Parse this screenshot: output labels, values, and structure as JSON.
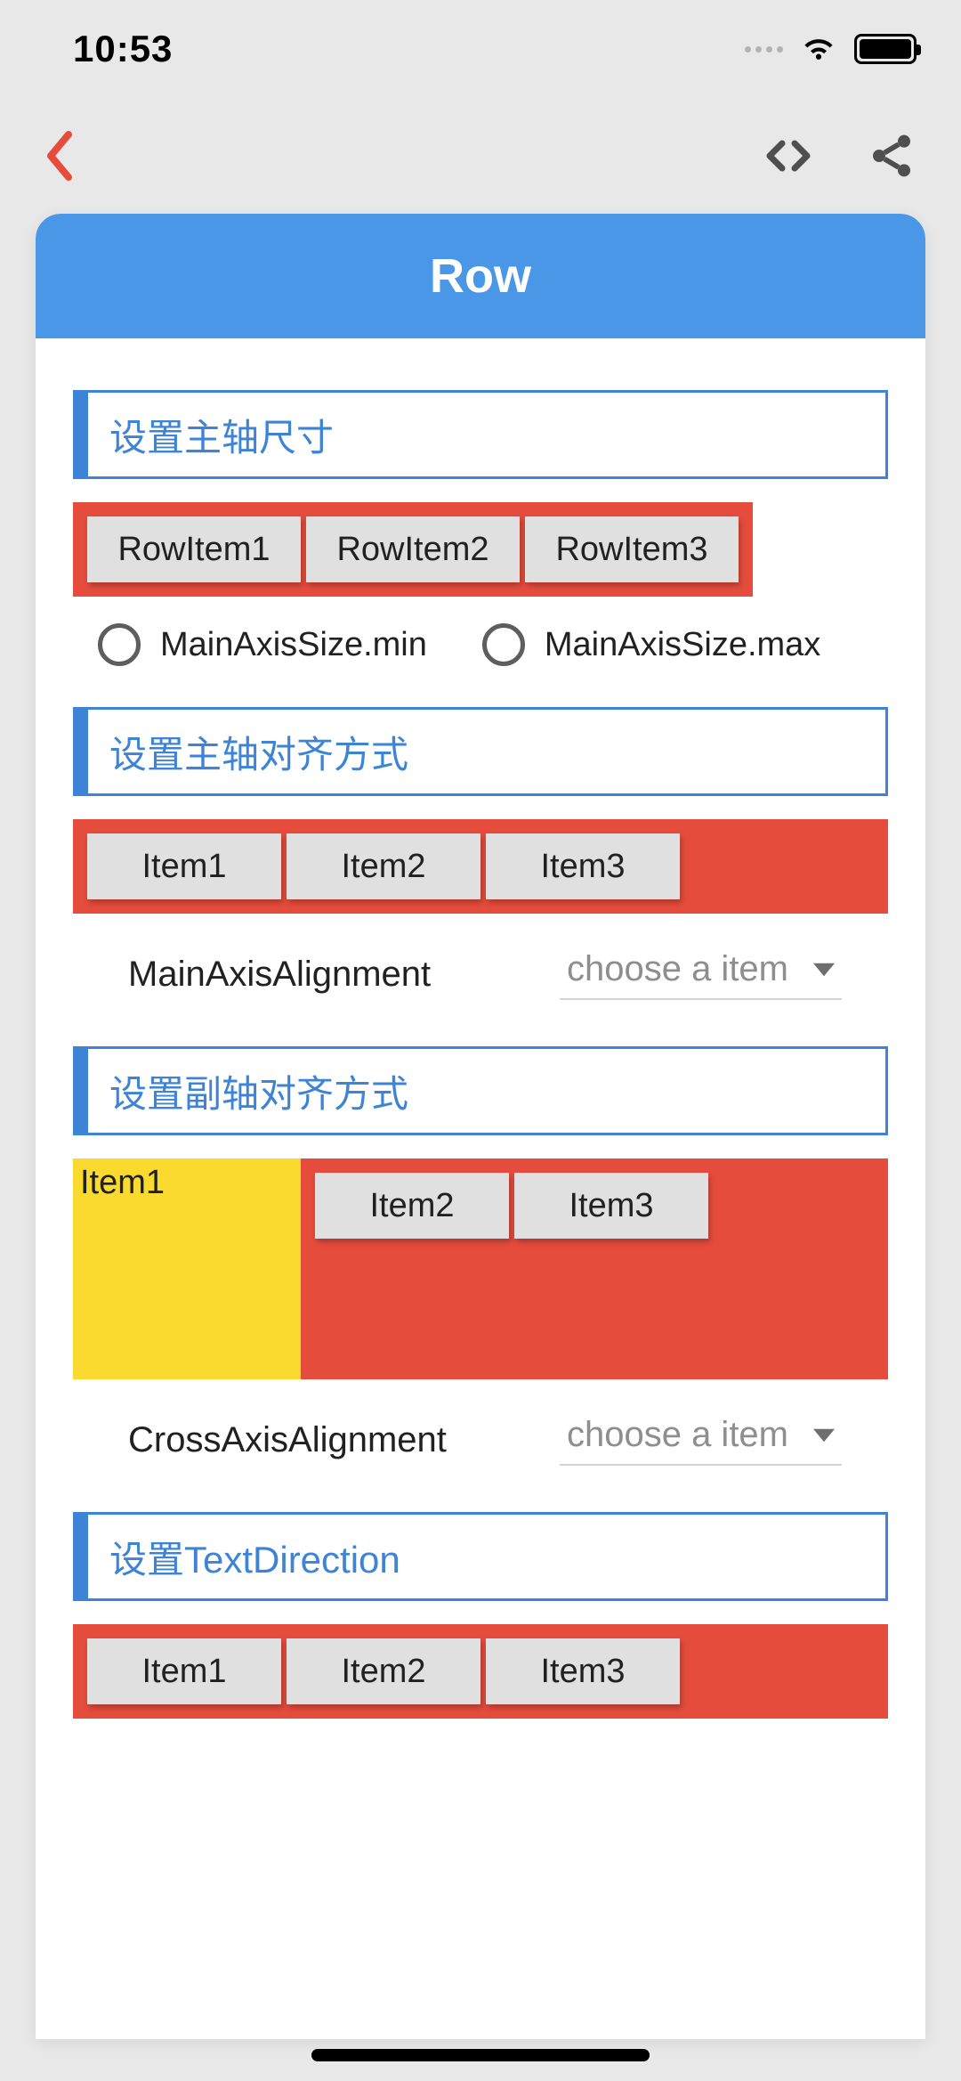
{
  "status": {
    "time": "10:53"
  },
  "header": {
    "title": "Row"
  },
  "sections": {
    "mainAxisSize": {
      "title": "设置主轴尺寸",
      "items": [
        "RowItem1",
        "RowItem2",
        "RowItem3"
      ],
      "options": [
        "MainAxisSize.min",
        "MainAxisSize.max"
      ]
    },
    "mainAxisAlignment": {
      "title": "设置主轴对齐方式",
      "items": [
        "Item1",
        "Item2",
        "Item3"
      ],
      "label": "MainAxisAlignment",
      "placeholder": "choose a item"
    },
    "crossAxisAlignment": {
      "title": "设置副轴对齐方式",
      "items": [
        "Item1",
        "Item2",
        "Item3"
      ],
      "label": "CrossAxisAlignment",
      "placeholder": "choose a item"
    },
    "textDirection": {
      "title": "设置TextDirection",
      "items": [
        "Item1",
        "Item2",
        "Item3"
      ]
    }
  }
}
